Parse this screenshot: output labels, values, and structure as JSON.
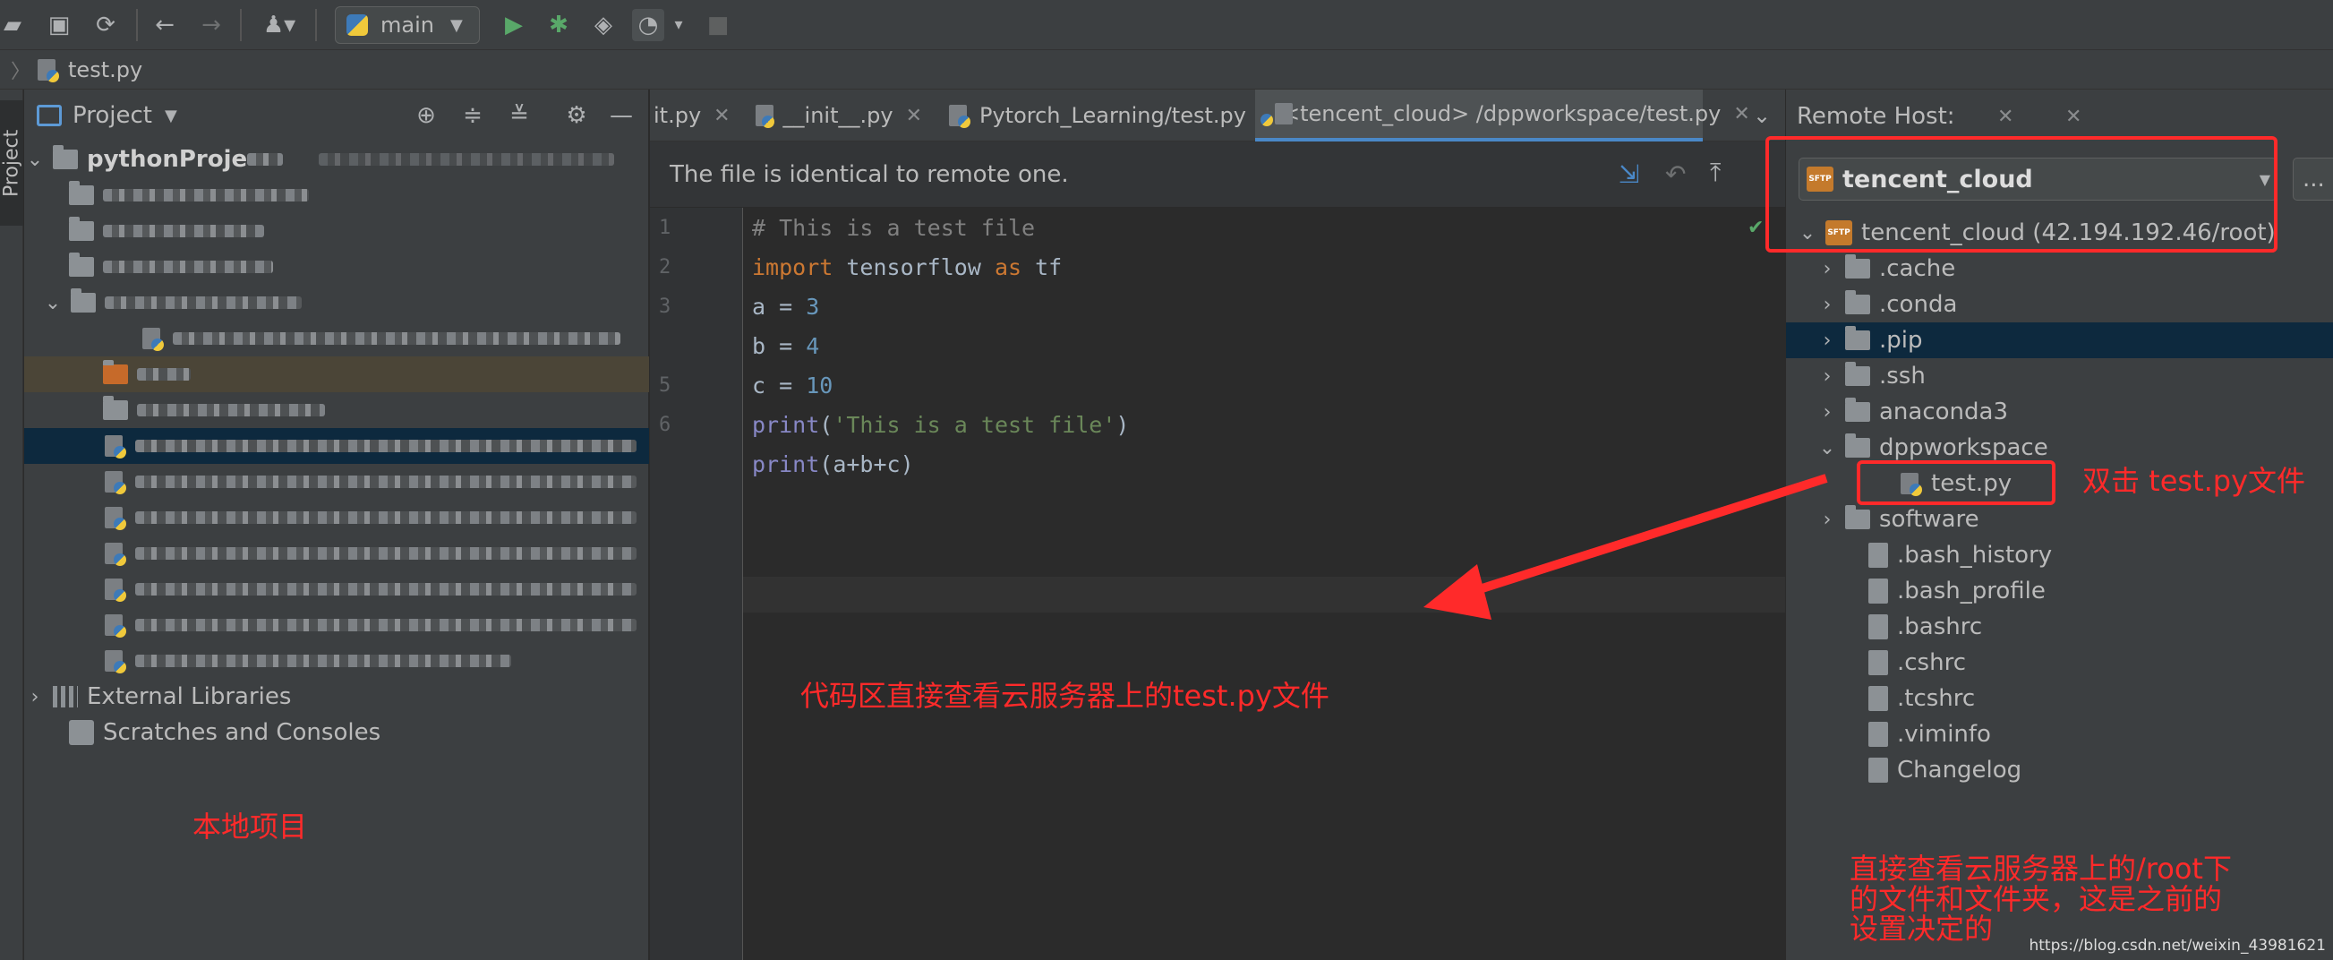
{
  "toolbar": {
    "run_config": "main",
    "icons": [
      "open-folder-icon",
      "save-icon",
      "sync-icon",
      "back-arrow-icon",
      "forward-arrow-icon",
      "vcs-user-icon",
      "python-icon",
      "run-icon",
      "debug-icon",
      "coverage-icon",
      "profile-icon",
      "stop-icon"
    ]
  },
  "breadcrumb": {
    "file": "test.py"
  },
  "left_strip": {
    "project_tab": "Project"
  },
  "project_panel": {
    "title": "Project",
    "root": "pythonProje",
    "external_libraries": "External Libraries",
    "scratches": "Scratches and Consoles"
  },
  "editor": {
    "tabs": [
      {
        "label": "it.py"
      },
      {
        "label": "__init__.py"
      },
      {
        "label": "Pytorch_Learning/test.py"
      },
      {
        "label": "<tencent_cloud> /dppworkspace/test.py"
      }
    ],
    "notice": "The file is identical to remote one.",
    "line_numbers": [
      "1",
      "2",
      "3",
      "",
      "5",
      "6",
      ""
    ],
    "code": {
      "l1": "# This is a test file",
      "l2_kw": "import",
      "l2_mod": " tensorflow ",
      "l2_as": "as",
      "l2_alias": " tf",
      "l3_var": "a = ",
      "l3_num": "3",
      "l4_var": "b = ",
      "l4_num": "4",
      "l5_var": "c = ",
      "l5_num": "10",
      "l6_fn": "print",
      "l6_open": "(",
      "l6_str": "'This is a test file'",
      "l6_close": ")",
      "l7_fn": "print",
      "l7_rest": "(a+b+c)"
    }
  },
  "remote_panel": {
    "title": "Remote Host:",
    "server_select": "tencent_cloud",
    "more": "...",
    "root": "tencent_cloud (42.194.192.46/root)",
    "items": [
      {
        "label": ".cache",
        "type": "folder"
      },
      {
        "label": ".conda",
        "type": "folder"
      },
      {
        "label": ".pip",
        "type": "folder"
      },
      {
        "label": ".ssh",
        "type": "folder"
      },
      {
        "label": "anaconda3",
        "type": "folder"
      },
      {
        "label": "dppworkspace",
        "type": "folder-open"
      },
      {
        "label": "test.py",
        "type": "py"
      },
      {
        "label": "software",
        "type": "folder"
      },
      {
        "label": ".bash_history",
        "type": "file"
      },
      {
        "label": ".bash_profile",
        "type": "file"
      },
      {
        "label": ".bashrc",
        "type": "file"
      },
      {
        "label": ".cshrc",
        "type": "file"
      },
      {
        "label": ".tcshrc",
        "type": "file"
      },
      {
        "label": ".viminfo",
        "type": "file"
      },
      {
        "label": "Changelog",
        "type": "file"
      }
    ]
  },
  "annotations": {
    "double_click": "双击 test.py文件",
    "code_view": "代码区直接查看云服务器上的test.py文件",
    "local_project": "本地项目",
    "remote_note_1": "直接查看云服务器上的/root下",
    "remote_note_2": "的文件和文件夹，这是之前的",
    "remote_note_3": "设置决定的"
  },
  "watermark": "https://blog.csdn.net/weixin_43981621",
  "colors": {
    "annotation_red": "#ff2a2a",
    "selection": "#0d293e",
    "keyword": "#cc7832",
    "number": "#6897bb",
    "string": "#6a8759"
  }
}
